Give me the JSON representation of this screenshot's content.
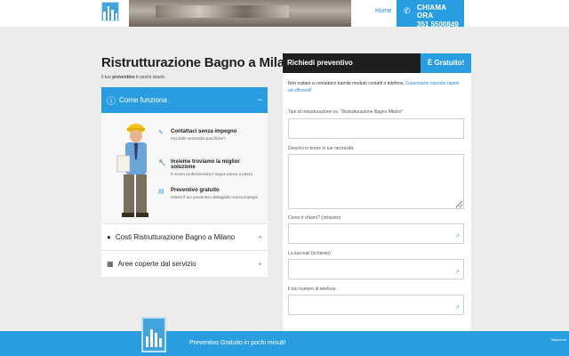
{
  "header": {
    "nav_home": "Home",
    "call_title": "CHIAMA ORA",
    "call_number": "351 5500849"
  },
  "page": {
    "title": "Ristrutturazione Bagno a Milano",
    "subtitle_prefix": "Il tuo ",
    "subtitle_bold": "preventivo",
    "subtitle_suffix": " in pochi istanti."
  },
  "accordion": {
    "active": {
      "label": "Come funziona",
      "toggle": "−",
      "icon": "question-circle-icon"
    },
    "steps": [
      {
        "title": "Contattaci senza impegno",
        "text": "Hai delle necessità specifiche?",
        "icon": "pencil-icon"
      },
      {
        "title": "Insieme troviamo la miglior soluzione",
        "text": "Il nostro professionista ti segue passo a passo",
        "icon": "wrench-icon"
      },
      {
        "title": "Preventivo gratuito",
        "text": "Ottieni il tuo preventivo dettagliato senza impegni",
        "icon": "document-icon"
      }
    ],
    "items": [
      {
        "label": "Costi Ristrutturazione Bagno a Milano",
        "toggle": "+",
        "icon": "coin-icon"
      },
      {
        "label": "Aree coperte dal servizio",
        "toggle": "+",
        "icon": "map-icon"
      }
    ]
  },
  "form": {
    "title": "Richiedi preventivo",
    "badge": "È Gratuito!",
    "intro_prefix": "Non esitare a contattarci tramite modulo contatti o telefono. ",
    "intro_highlight": "Garantiamo risposte rapide ed efficienti!",
    "fields": [
      {
        "label": "Tipo di ristrutturazione es. \"Ristrutturazione Bagno Milano\"",
        "value": ""
      },
      {
        "label": "Descrivi in breve le tue necessità:",
        "value": ""
      },
      {
        "label": "Come ti chiami? (richiesto)",
        "value": ""
      },
      {
        "label": "La tua mail (richiesto)",
        "value": ""
      },
      {
        "label": "Il tuo numero di telefono",
        "value": ""
      }
    ]
  },
  "bottom": {
    "text": "Preventivo Gratuito in pochi minuti!",
    "small": "Nascondi"
  },
  "colors": {
    "accent": "#2a9de1",
    "dark": "#1f1f1f",
    "background": "#ececec"
  }
}
